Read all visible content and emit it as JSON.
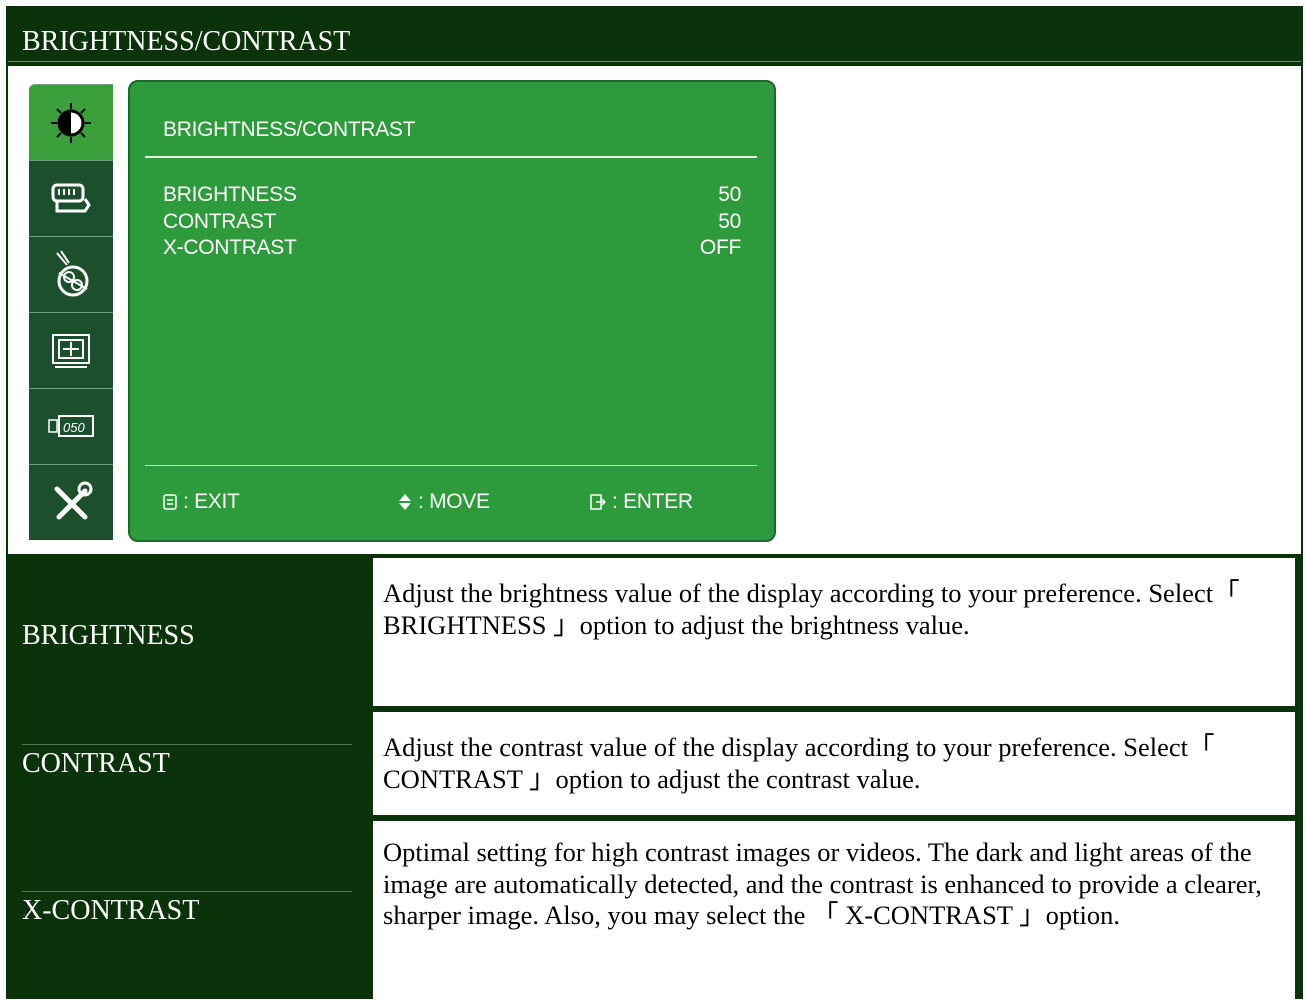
{
  "header": {
    "title": "BRIGHTNESS/CONTRAST"
  },
  "osd": {
    "sidebar": [
      {
        "icon": "brightness-contrast-icon",
        "active": true
      },
      {
        "icon": "input-source-icon",
        "active": false
      },
      {
        "icon": "color-icon",
        "active": false
      },
      {
        "icon": "image-position-icon",
        "active": false
      },
      {
        "icon": "osd-settings-icon",
        "active": false
      },
      {
        "icon": "tools-icon",
        "active": false
      }
    ],
    "title": "BRIGHTNESS/CONTRAST",
    "items": [
      {
        "label": "BRIGHTNESS",
        "value": "50"
      },
      {
        "label": "CONTRAST",
        "value": "50"
      },
      {
        "label": "X-CONTRAST",
        "value": "OFF"
      }
    ],
    "footer": {
      "exit": ": EXIT",
      "move": ": MOVE",
      "enter": ": ENTER"
    }
  },
  "table": [
    {
      "label": "BRIGHTNESS",
      "desc": "Adjust the brightness value of the display according to your preference. Select「 BRIGHTNESS 」option to adjust the brightness value."
    },
    {
      "label": "CONTRAST",
      "desc": "Adjust the contrast value of the display according to your preference. Select「 CONTRAST 」option to adjust the contrast value."
    },
    {
      "label": "X-CONTRAST",
      "desc": "Optimal setting for high contrast images or videos. The dark and light areas of the image are automatically detected, and the contrast is enhanced to provide a clearer, sharper image. Also, you may select the 「 X-CONTRAST 」option."
    }
  ]
}
